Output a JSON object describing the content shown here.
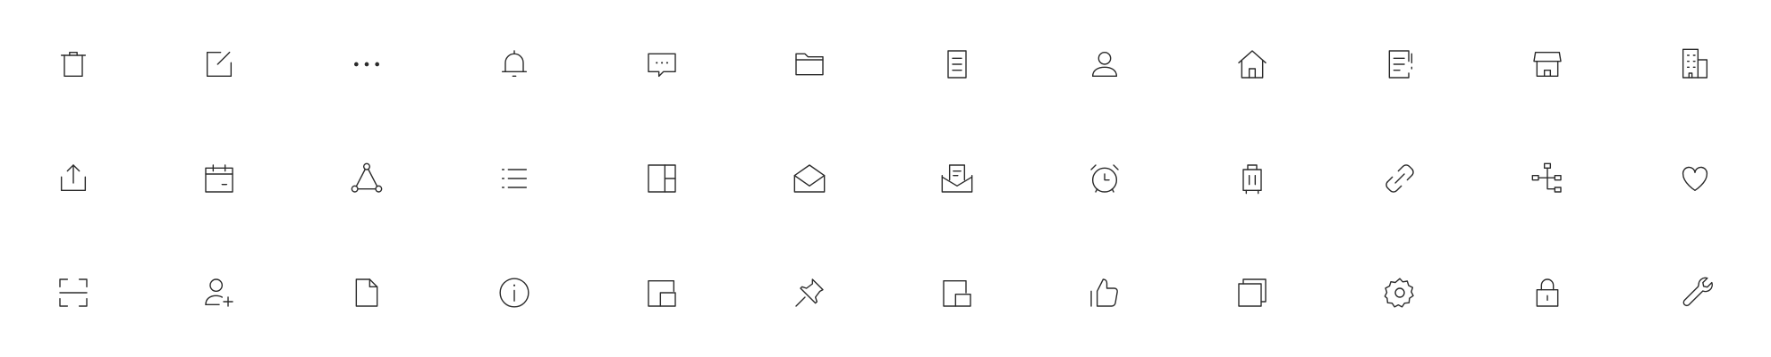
{
  "icon_color": "#2b2b2b",
  "rows": [
    [
      "delete-icon",
      "edit-icon",
      "more-icon",
      "bell-icon",
      "comment-icon",
      "folder-icon",
      "document-icon",
      "user-icon",
      "home-icon",
      "report-icon",
      "shop-icon",
      "building-icon"
    ],
    [
      "share-icon",
      "calendar-icon",
      "network-icon",
      "list-icon",
      "layout-icon",
      "mail-open-icon",
      "mail-message-icon",
      "alarm-clock-icon",
      "luggage-icon",
      "link-icon",
      "org-chart-icon",
      "heart-icon"
    ],
    [
      "scan-icon",
      "add-user-icon",
      "file-icon",
      "info-icon",
      "picture-in-picture-icon",
      "pin-icon",
      "minimize-window-icon",
      "thumbs-up-icon",
      "copy-icon",
      "settings-icon",
      "lock-icon",
      "wrench-icon"
    ]
  ]
}
